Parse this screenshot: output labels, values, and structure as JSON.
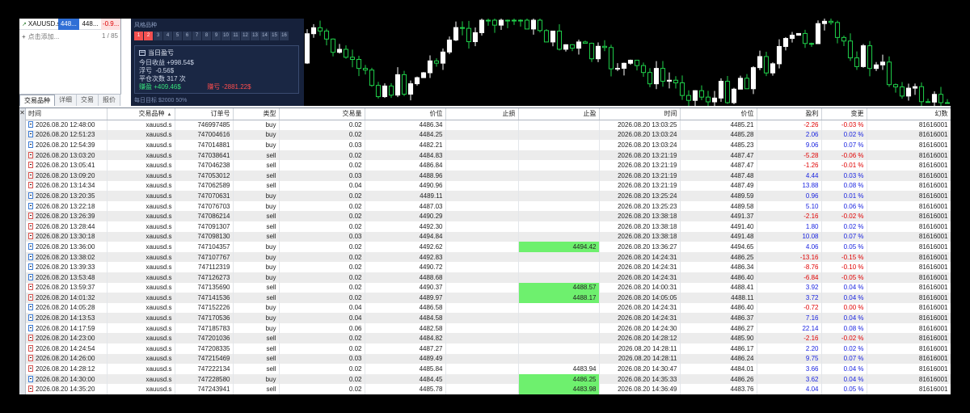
{
  "watch": {
    "symbol": "XAUUSD.s",
    "bid": "448...",
    "ask": "448...",
    "change": "-0.9...",
    "add_label": "点击添加...",
    "count": "1 / 85",
    "tabs": [
      "交易品种",
      "详细",
      "交易",
      "报价"
    ]
  },
  "strategy": {
    "header": "风格品种",
    "boxes": [
      "1",
      "2",
      "3",
      "4",
      "5",
      "6",
      "7",
      "8",
      "9",
      "10",
      "11",
      "12",
      "13",
      "14",
      "15",
      "16"
    ],
    "active_boxes": 2,
    "card_title": "当日盈亏",
    "today_label": "今日收益",
    "today_value": "+998.54$",
    "float_label": "浮亏",
    "float_value": "-0.56$",
    "trades_label": "平仓次数",
    "trades_value": "317 次",
    "profit_label": "赚盈",
    "profit_value": "+409.46$",
    "loss_label": "赚亏",
    "loss_value": "-2881.22$",
    "footer": "每日目标 $2000  50%"
  },
  "table": {
    "headers": [
      "时间",
      "交易品种",
      "订单号",
      "类型",
      "交易量",
      "价位",
      "止损",
      "止盈",
      "时间",
      "价位",
      "盈利",
      "变更",
      "幻数"
    ],
    "rows": [
      [
        "2026.08.20 12:48:00",
        "xauusd.s",
        "746997485",
        "buy",
        "0.02",
        "4486.34",
        "",
        "",
        "2026.08.20 13:03:25",
        "4485.21",
        "-2.26",
        "-0.03 %",
        "81616001"
      ],
      [
        "2026.08.20 12:51:23",
        "xauusd.s",
        "747004616",
        "buy",
        "0.02",
        "4484.25",
        "",
        "",
        "2026.08.20 13:03:24",
        "4485.28",
        "2.06",
        "0.02 %",
        "81616001"
      ],
      [
        "2026.08.20 12:54:39",
        "xauusd.s",
        "747014881",
        "buy",
        "0.03",
        "4482.21",
        "",
        "",
        "2026.08.20 13:03:24",
        "4485.23",
        "9.06",
        "0.07 %",
        "81616001"
      ],
      [
        "2026.08.20 13:03:20",
        "xauusd.s",
        "747038641",
        "sell",
        "0.02",
        "4484.83",
        "",
        "",
        "2026.08.20 13:21:19",
        "4487.47",
        "-5.28",
        "-0.06 %",
        "81616001"
      ],
      [
        "2026.08.20 13:05:41",
        "xauusd.s",
        "747046238",
        "sell",
        "0.02",
        "4486.84",
        "",
        "",
        "2026.08.20 13:21:19",
        "4487.47",
        "-1.26",
        "-0.01 %",
        "81616001"
      ],
      [
        "2026.08.20 13:09:20",
        "xauusd.s",
        "747053012",
        "sell",
        "0.03",
        "4488.96",
        "",
        "",
        "2026.08.20 13:21:19",
        "4487.48",
        "4.44",
        "0.03 %",
        "81616001"
      ],
      [
        "2026.08.20 13:14:34",
        "xauusd.s",
        "747062589",
        "sell",
        "0.04",
        "4490.96",
        "",
        "",
        "2026.08.20 13:21:19",
        "4487.49",
        "13.88",
        "0.08 %",
        "81616001"
      ],
      [
        "2026.08.20 13:20:35",
        "xauusd.s",
        "747070631",
        "buy",
        "0.02",
        "4489.11",
        "",
        "",
        "2026.08.20 13:25:24",
        "4489.59",
        "0.96",
        "0.01 %",
        "81616001"
      ],
      [
        "2026.08.20 13:22:18",
        "xauusd.s",
        "747076703",
        "buy",
        "0.02",
        "4487.03",
        "",
        "",
        "2026.08.20 13:25:23",
        "4489.58",
        "5.10",
        "0.06 %",
        "81616001"
      ],
      [
        "2026.08.20 13:26:39",
        "xauusd.s",
        "747086214",
        "sell",
        "0.02",
        "4490.29",
        "",
        "",
        "2026.08.20 13:38:18",
        "4491.37",
        "-2.16",
        "-0.02 %",
        "81616001"
      ],
      [
        "2026.08.20 13:28:44",
        "xauusd.s",
        "747091307",
        "sell",
        "0.02",
        "4492.30",
        "",
        "",
        "2026.08.20 13:38:18",
        "4491.40",
        "1.80",
        "0.02 %",
        "81616001"
      ],
      [
        "2026.08.20 13:30:18",
        "xauusd.s",
        "747098130",
        "sell",
        "0.03",
        "4494.84",
        "",
        "",
        "2026.08.20 13:38:18",
        "4491.48",
        "10.08",
        "0.07 %",
        "81616001"
      ],
      [
        "2026.08.20 13:36:00",
        "xauusd.s",
        "747104357",
        "buy",
        "0.02",
        "4492.62",
        "",
        "4494.42",
        "2026.08.20 13:36:27",
        "4494.65",
        "4.06",
        "0.05 %",
        "81616001"
      ],
      [
        "2026.08.20 13:38:02",
        "xauusd.s",
        "747107767",
        "buy",
        "0.02",
        "4492.83",
        "",
        "",
        "2026.08.20 14:24:31",
        "4486.25",
        "-13.16",
        "-0.15 %",
        "81616001"
      ],
      [
        "2026.08.20 13:39:33",
        "xauusd.s",
        "747112319",
        "buy",
        "0.02",
        "4490.72",
        "",
        "",
        "2026.08.20 14:24:31",
        "4486.34",
        "-8.76",
        "-0.10 %",
        "81616001"
      ],
      [
        "2026.08.20 13:53:48",
        "xauusd.s",
        "747126273",
        "buy",
        "0.02",
        "4488.68",
        "",
        "",
        "2026.08.20 14:24:31",
        "4486.40",
        "-6.84",
        "-0.05 %",
        "81616001"
      ],
      [
        "2026.08.20 13:59:37",
        "xauusd.s",
        "747135690",
        "sell",
        "0.02",
        "4490.37",
        "",
        "4488.57",
        "2026.08.20 14:00:31",
        "4488.41",
        "3.92",
        "0.04 %",
        "81616001"
      ],
      [
        "2026.08.20 14:01:32",
        "xauusd.s",
        "747141536",
        "sell",
        "0.02",
        "4489.97",
        "",
        "4488.17",
        "2026.08.20 14:05:05",
        "4488.11",
        "3.72",
        "0.04 %",
        "81616001"
      ],
      [
        "2026.08.20 14:05:28",
        "xauusd.s",
        "747152226",
        "buy",
        "0.04",
        "4486.58",
        "",
        "",
        "2026.08.20 14:24:31",
        "4486.40",
        "-0.72",
        "0.00 %",
        "81616001"
      ],
      [
        "2026.08.20 14:13:53",
        "xauusd.s",
        "747170536",
        "buy",
        "0.04",
        "4484.58",
        "",
        "",
        "2026.08.20 14:24:31",
        "4486.37",
        "7.16",
        "0.04 %",
        "81616001"
      ],
      [
        "2026.08.20 14:17:59",
        "xauusd.s",
        "747185783",
        "buy",
        "0.06",
        "4482.58",
        "",
        "",
        "2026.08.20 14:24:30",
        "4486.27",
        "22.14",
        "0.08 %",
        "81616001"
      ],
      [
        "2026.08.20 14:23:00",
        "xauusd.s",
        "747201036",
        "sell",
        "0.02",
        "4484.82",
        "",
        "",
        "2026.08.20 14:28:12",
        "4485.90",
        "-2.16",
        "-0.02 %",
        "81616001"
      ],
      [
        "2026.08.20 14:24:54",
        "xauusd.s",
        "747208335",
        "sell",
        "0.02",
        "4487.27",
        "",
        "",
        "2026.08.20 14:28:11",
        "4486.17",
        "2.20",
        "0.02 %",
        "81616001"
      ],
      [
        "2026.08.20 14:26:00",
        "xauusd.s",
        "747215469",
        "sell",
        "0.03",
        "4489.49",
        "",
        "",
        "2026.08.20 14:28:11",
        "4486.24",
        "9.75",
        "0.07 %",
        "81616001"
      ],
      [
        "2026.08.20 14:28:12",
        "xauusd.s",
        "747222134",
        "sell",
        "0.02",
        "4485.84",
        "",
        "4483.94",
        "2026.08.20 14:30:47",
        "4484.01",
        "3.66",
        "0.04 %",
        "81616001"
      ],
      [
        "2026.08.20 14:30:00",
        "xauusd.s",
        "747228580",
        "buy",
        "0.02",
        "4484.45",
        "",
        "4486.25",
        "2026.08.20 14:35:33",
        "4486.26",
        "3.62",
        "0.04 %",
        "81616001"
      ],
      [
        "2026.08.20 14:35:20",
        "xauusd.s",
        "747243941",
        "sell",
        "0.02",
        "4485.78",
        "",
        "4483.98",
        "2026.08.20 14:36:49",
        "4483.76",
        "4.04",
        "0.05 %",
        "81616001"
      ]
    ],
    "highlighted_tp_rows": [
      12,
      16,
      17,
      25,
      26
    ]
  },
  "colors": {
    "profit_positive": "#1a24e0",
    "profit_negative": "#e00000",
    "tp_highlight": "#6ef06e",
    "panel_bg": "#16213b",
    "candle_up": "#ffffff",
    "candle_down": "#1fd14a"
  },
  "icons": {
    "buy": "document-buy-icon",
    "sell": "document-sell-icon",
    "close": "close-icon",
    "wallet": "wallet-icon"
  }
}
